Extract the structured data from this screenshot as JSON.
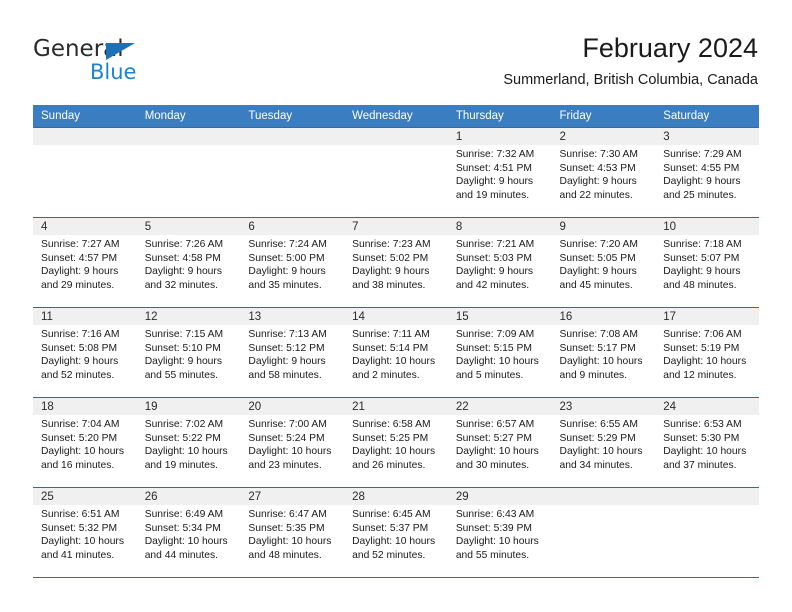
{
  "brand": {
    "name_top": "General",
    "name_bottom": "Blue",
    "triangle_color": "#1c71b9",
    "blue_text_color": "#1c83d4"
  },
  "header": {
    "title": "February 2024",
    "subtitle": "Summerland, British Columbia, Canada"
  },
  "theme": {
    "header_blue": "#3a7dc0",
    "border_blue": "#2e6da4",
    "daynum_band": "#f0f0f0"
  },
  "weekdays": [
    "Sunday",
    "Monday",
    "Tuesday",
    "Wednesday",
    "Thursday",
    "Friday",
    "Saturday"
  ],
  "weeks": [
    [
      {
        "day": "",
        "lines": []
      },
      {
        "day": "",
        "lines": []
      },
      {
        "day": "",
        "lines": []
      },
      {
        "day": "",
        "lines": []
      },
      {
        "day": "1",
        "lines": [
          "Sunrise: 7:32 AM",
          "Sunset: 4:51 PM",
          "Daylight: 9 hours",
          "and 19 minutes."
        ]
      },
      {
        "day": "2",
        "lines": [
          "Sunrise: 7:30 AM",
          "Sunset: 4:53 PM",
          "Daylight: 9 hours",
          "and 22 minutes."
        ]
      },
      {
        "day": "3",
        "lines": [
          "Sunrise: 7:29 AM",
          "Sunset: 4:55 PM",
          "Daylight: 9 hours",
          "and 25 minutes."
        ]
      }
    ],
    [
      {
        "day": "4",
        "lines": [
          "Sunrise: 7:27 AM",
          "Sunset: 4:57 PM",
          "Daylight: 9 hours",
          "and 29 minutes."
        ]
      },
      {
        "day": "5",
        "lines": [
          "Sunrise: 7:26 AM",
          "Sunset: 4:58 PM",
          "Daylight: 9 hours",
          "and 32 minutes."
        ]
      },
      {
        "day": "6",
        "lines": [
          "Sunrise: 7:24 AM",
          "Sunset: 5:00 PM",
          "Daylight: 9 hours",
          "and 35 minutes."
        ]
      },
      {
        "day": "7",
        "lines": [
          "Sunrise: 7:23 AM",
          "Sunset: 5:02 PM",
          "Daylight: 9 hours",
          "and 38 minutes."
        ]
      },
      {
        "day": "8",
        "lines": [
          "Sunrise: 7:21 AM",
          "Sunset: 5:03 PM",
          "Daylight: 9 hours",
          "and 42 minutes."
        ]
      },
      {
        "day": "9",
        "lines": [
          "Sunrise: 7:20 AM",
          "Sunset: 5:05 PM",
          "Daylight: 9 hours",
          "and 45 minutes."
        ]
      },
      {
        "day": "10",
        "lines": [
          "Sunrise: 7:18 AM",
          "Sunset: 5:07 PM",
          "Daylight: 9 hours",
          "and 48 minutes."
        ]
      }
    ],
    [
      {
        "day": "11",
        "lines": [
          "Sunrise: 7:16 AM",
          "Sunset: 5:08 PM",
          "Daylight: 9 hours",
          "and 52 minutes."
        ]
      },
      {
        "day": "12",
        "lines": [
          "Sunrise: 7:15 AM",
          "Sunset: 5:10 PM",
          "Daylight: 9 hours",
          "and 55 minutes."
        ]
      },
      {
        "day": "13",
        "lines": [
          "Sunrise: 7:13 AM",
          "Sunset: 5:12 PM",
          "Daylight: 9 hours",
          "and 58 minutes."
        ]
      },
      {
        "day": "14",
        "lines": [
          "Sunrise: 7:11 AM",
          "Sunset: 5:14 PM",
          "Daylight: 10 hours",
          "and 2 minutes."
        ]
      },
      {
        "day": "15",
        "lines": [
          "Sunrise: 7:09 AM",
          "Sunset: 5:15 PM",
          "Daylight: 10 hours",
          "and 5 minutes."
        ]
      },
      {
        "day": "16",
        "lines": [
          "Sunrise: 7:08 AM",
          "Sunset: 5:17 PM",
          "Daylight: 10 hours",
          "and 9 minutes."
        ]
      },
      {
        "day": "17",
        "lines": [
          "Sunrise: 7:06 AM",
          "Sunset: 5:19 PM",
          "Daylight: 10 hours",
          "and 12 minutes."
        ]
      }
    ],
    [
      {
        "day": "18",
        "lines": [
          "Sunrise: 7:04 AM",
          "Sunset: 5:20 PM",
          "Daylight: 10 hours",
          "and 16 minutes."
        ]
      },
      {
        "day": "19",
        "lines": [
          "Sunrise: 7:02 AM",
          "Sunset: 5:22 PM",
          "Daylight: 10 hours",
          "and 19 minutes."
        ]
      },
      {
        "day": "20",
        "lines": [
          "Sunrise: 7:00 AM",
          "Sunset: 5:24 PM",
          "Daylight: 10 hours",
          "and 23 minutes."
        ]
      },
      {
        "day": "21",
        "lines": [
          "Sunrise: 6:58 AM",
          "Sunset: 5:25 PM",
          "Daylight: 10 hours",
          "and 26 minutes."
        ]
      },
      {
        "day": "22",
        "lines": [
          "Sunrise: 6:57 AM",
          "Sunset: 5:27 PM",
          "Daylight: 10 hours",
          "and 30 minutes."
        ]
      },
      {
        "day": "23",
        "lines": [
          "Sunrise: 6:55 AM",
          "Sunset: 5:29 PM",
          "Daylight: 10 hours",
          "and 34 minutes."
        ]
      },
      {
        "day": "24",
        "lines": [
          "Sunrise: 6:53 AM",
          "Sunset: 5:30 PM",
          "Daylight: 10 hours",
          "and 37 minutes."
        ]
      }
    ],
    [
      {
        "day": "25",
        "lines": [
          "Sunrise: 6:51 AM",
          "Sunset: 5:32 PM",
          "Daylight: 10 hours",
          "and 41 minutes."
        ]
      },
      {
        "day": "26",
        "lines": [
          "Sunrise: 6:49 AM",
          "Sunset: 5:34 PM",
          "Daylight: 10 hours",
          "and 44 minutes."
        ]
      },
      {
        "day": "27",
        "lines": [
          "Sunrise: 6:47 AM",
          "Sunset: 5:35 PM",
          "Daylight: 10 hours",
          "and 48 minutes."
        ]
      },
      {
        "day": "28",
        "lines": [
          "Sunrise: 6:45 AM",
          "Sunset: 5:37 PM",
          "Daylight: 10 hours",
          "and 52 minutes."
        ]
      },
      {
        "day": "29",
        "lines": [
          "Sunrise: 6:43 AM",
          "Sunset: 5:39 PM",
          "Daylight: 10 hours",
          "and 55 minutes."
        ]
      },
      {
        "day": "",
        "lines": []
      },
      {
        "day": "",
        "lines": []
      }
    ]
  ]
}
